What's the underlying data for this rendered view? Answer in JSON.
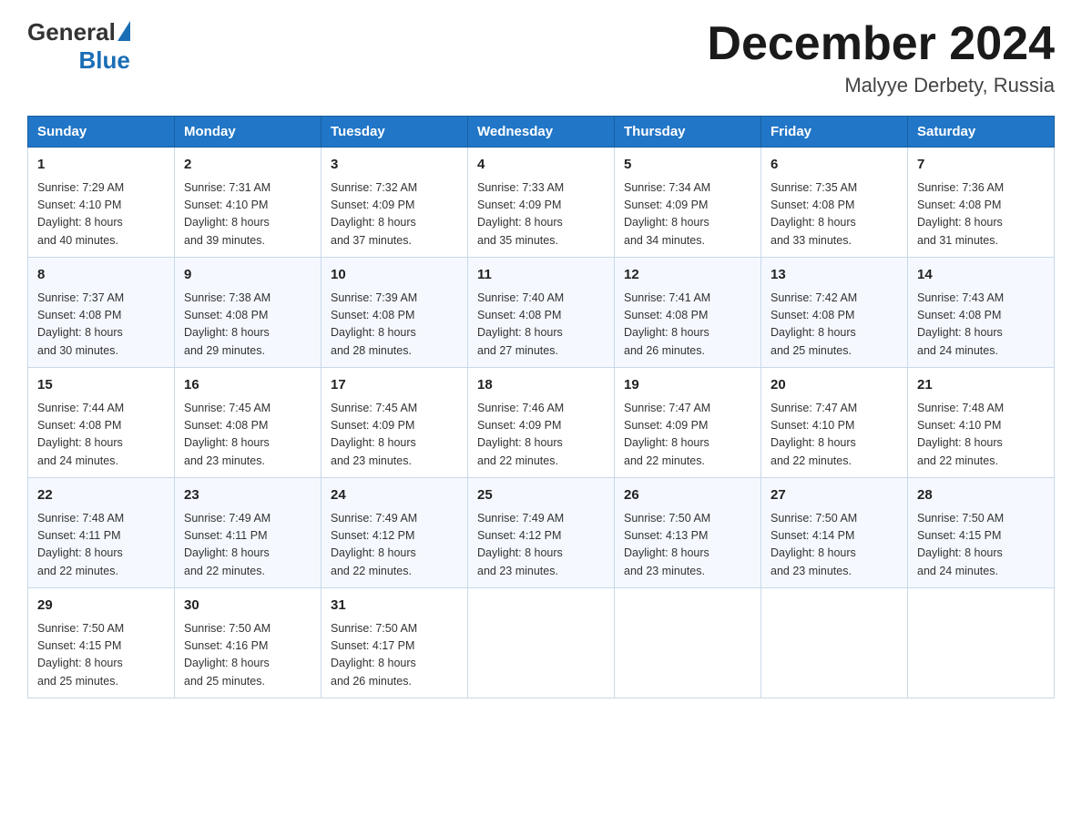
{
  "header": {
    "logo_general": "General",
    "logo_blue": "Blue",
    "month_title": "December 2024",
    "location": "Malyye Derbety, Russia"
  },
  "days_of_week": [
    "Sunday",
    "Monday",
    "Tuesday",
    "Wednesday",
    "Thursday",
    "Friday",
    "Saturday"
  ],
  "weeks": [
    [
      {
        "day": "1",
        "sunrise": "7:29 AM",
        "sunset": "4:10 PM",
        "daylight": "8 hours and 40 minutes."
      },
      {
        "day": "2",
        "sunrise": "7:31 AM",
        "sunset": "4:10 PM",
        "daylight": "8 hours and 39 minutes."
      },
      {
        "day": "3",
        "sunrise": "7:32 AM",
        "sunset": "4:09 PM",
        "daylight": "8 hours and 37 minutes."
      },
      {
        "day": "4",
        "sunrise": "7:33 AM",
        "sunset": "4:09 PM",
        "daylight": "8 hours and 35 minutes."
      },
      {
        "day": "5",
        "sunrise": "7:34 AM",
        "sunset": "4:09 PM",
        "daylight": "8 hours and 34 minutes."
      },
      {
        "day": "6",
        "sunrise": "7:35 AM",
        "sunset": "4:08 PM",
        "daylight": "8 hours and 33 minutes."
      },
      {
        "day": "7",
        "sunrise": "7:36 AM",
        "sunset": "4:08 PM",
        "daylight": "8 hours and 31 minutes."
      }
    ],
    [
      {
        "day": "8",
        "sunrise": "7:37 AM",
        "sunset": "4:08 PM",
        "daylight": "8 hours and 30 minutes."
      },
      {
        "day": "9",
        "sunrise": "7:38 AM",
        "sunset": "4:08 PM",
        "daylight": "8 hours and 29 minutes."
      },
      {
        "day": "10",
        "sunrise": "7:39 AM",
        "sunset": "4:08 PM",
        "daylight": "8 hours and 28 minutes."
      },
      {
        "day": "11",
        "sunrise": "7:40 AM",
        "sunset": "4:08 PM",
        "daylight": "8 hours and 27 minutes."
      },
      {
        "day": "12",
        "sunrise": "7:41 AM",
        "sunset": "4:08 PM",
        "daylight": "8 hours and 26 minutes."
      },
      {
        "day": "13",
        "sunrise": "7:42 AM",
        "sunset": "4:08 PM",
        "daylight": "8 hours and 25 minutes."
      },
      {
        "day": "14",
        "sunrise": "7:43 AM",
        "sunset": "4:08 PM",
        "daylight": "8 hours and 24 minutes."
      }
    ],
    [
      {
        "day": "15",
        "sunrise": "7:44 AM",
        "sunset": "4:08 PM",
        "daylight": "8 hours and 24 minutes."
      },
      {
        "day": "16",
        "sunrise": "7:45 AM",
        "sunset": "4:08 PM",
        "daylight": "8 hours and 23 minutes."
      },
      {
        "day": "17",
        "sunrise": "7:45 AM",
        "sunset": "4:09 PM",
        "daylight": "8 hours and 23 minutes."
      },
      {
        "day": "18",
        "sunrise": "7:46 AM",
        "sunset": "4:09 PM",
        "daylight": "8 hours and 22 minutes."
      },
      {
        "day": "19",
        "sunrise": "7:47 AM",
        "sunset": "4:09 PM",
        "daylight": "8 hours and 22 minutes."
      },
      {
        "day": "20",
        "sunrise": "7:47 AM",
        "sunset": "4:10 PM",
        "daylight": "8 hours and 22 minutes."
      },
      {
        "day": "21",
        "sunrise": "7:48 AM",
        "sunset": "4:10 PM",
        "daylight": "8 hours and 22 minutes."
      }
    ],
    [
      {
        "day": "22",
        "sunrise": "7:48 AM",
        "sunset": "4:11 PM",
        "daylight": "8 hours and 22 minutes."
      },
      {
        "day": "23",
        "sunrise": "7:49 AM",
        "sunset": "4:11 PM",
        "daylight": "8 hours and 22 minutes."
      },
      {
        "day": "24",
        "sunrise": "7:49 AM",
        "sunset": "4:12 PM",
        "daylight": "8 hours and 22 minutes."
      },
      {
        "day": "25",
        "sunrise": "7:49 AM",
        "sunset": "4:12 PM",
        "daylight": "8 hours and 23 minutes."
      },
      {
        "day": "26",
        "sunrise": "7:50 AM",
        "sunset": "4:13 PM",
        "daylight": "8 hours and 23 minutes."
      },
      {
        "day": "27",
        "sunrise": "7:50 AM",
        "sunset": "4:14 PM",
        "daylight": "8 hours and 23 minutes."
      },
      {
        "day": "28",
        "sunrise": "7:50 AM",
        "sunset": "4:15 PM",
        "daylight": "8 hours and 24 minutes."
      }
    ],
    [
      {
        "day": "29",
        "sunrise": "7:50 AM",
        "sunset": "4:15 PM",
        "daylight": "8 hours and 25 minutes."
      },
      {
        "day": "30",
        "sunrise": "7:50 AM",
        "sunset": "4:16 PM",
        "daylight": "8 hours and 25 minutes."
      },
      {
        "day": "31",
        "sunrise": "7:50 AM",
        "sunset": "4:17 PM",
        "daylight": "8 hours and 26 minutes."
      },
      null,
      null,
      null,
      null
    ]
  ],
  "labels": {
    "sunrise": "Sunrise:",
    "sunset": "Sunset:",
    "daylight": "Daylight:"
  }
}
